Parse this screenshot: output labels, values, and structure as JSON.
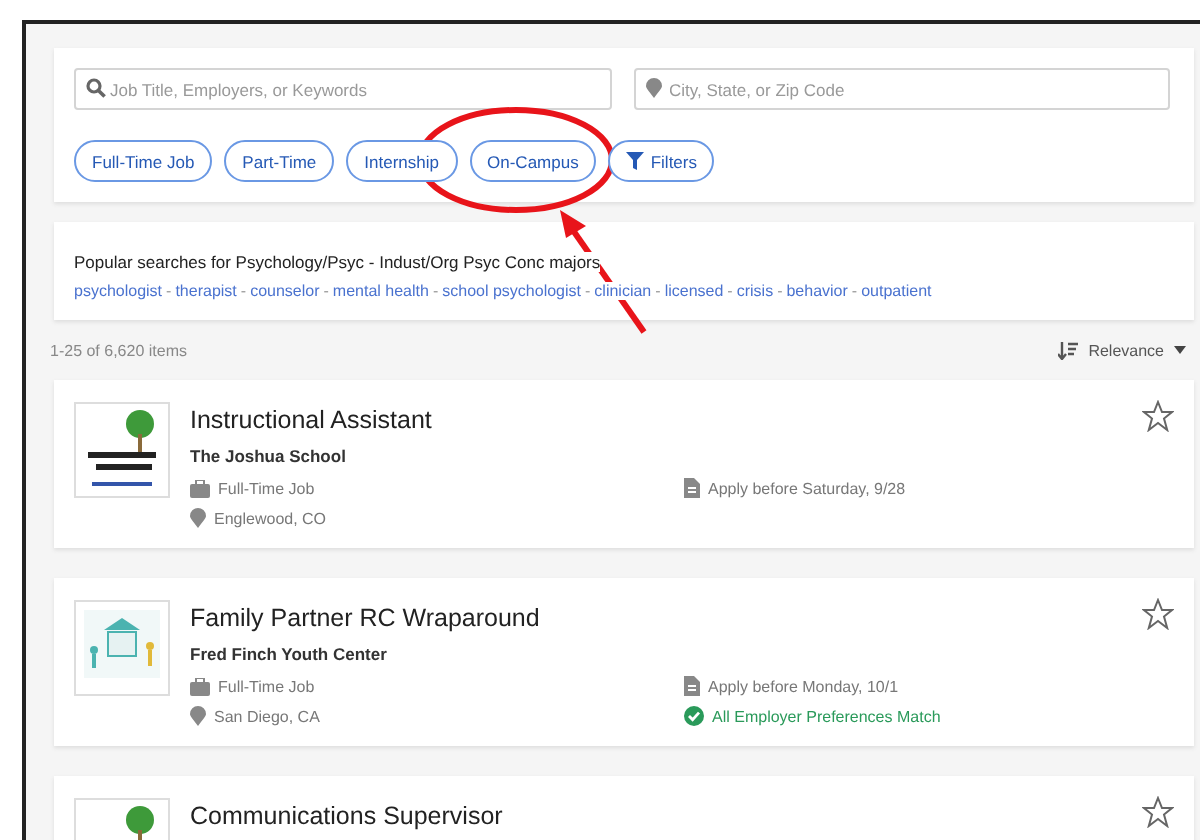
{
  "search": {
    "keyword": {
      "placeholder": "Job Title, Employers, or Keywords"
    },
    "location": {
      "placeholder": "City, State, or Zip Code"
    }
  },
  "chips": [
    {
      "label": "Full-Time Job",
      "kind": "plain",
      "selected": false
    },
    {
      "label": "Part-Time",
      "kind": "plain",
      "selected": false
    },
    {
      "label": "Internship",
      "kind": "plain",
      "selected": false
    },
    {
      "label": "On-Campus",
      "kind": "plain",
      "selected": false
    },
    {
      "label": "Filters",
      "kind": "filter",
      "selected": false
    }
  ],
  "popular": {
    "heading": "Popular searches for Psychology/Psyc - Indust/Org Psyc Conc majors",
    "separator": "-",
    "terms": [
      "psychologist",
      "therapist",
      "counselor",
      "mental health",
      "school psychologist",
      "clinician",
      "licensed",
      "crisis",
      "behavior",
      "outpatient"
    ]
  },
  "results": {
    "count": "1-25 of 6,620 items",
    "sort": "Relevance"
  },
  "jobs": [
    {
      "title": "Instructional Assistant",
      "employer": "The Joshua School",
      "type": "Full-Time Job",
      "location": "Englewood, CO",
      "deadline": "Apply before Saturday, 9/28",
      "starred": false
    },
    {
      "title": "Family Partner RC Wraparound",
      "employer": "Fred Finch Youth Center",
      "type": "Full-Time Job",
      "location": "San Diego, CA",
      "deadline": "Apply before Monday, 10/1",
      "match": "All Employer Preferences Match",
      "starred": false
    },
    {
      "title": "Communications Supervisor",
      "starred": false
    }
  ]
}
